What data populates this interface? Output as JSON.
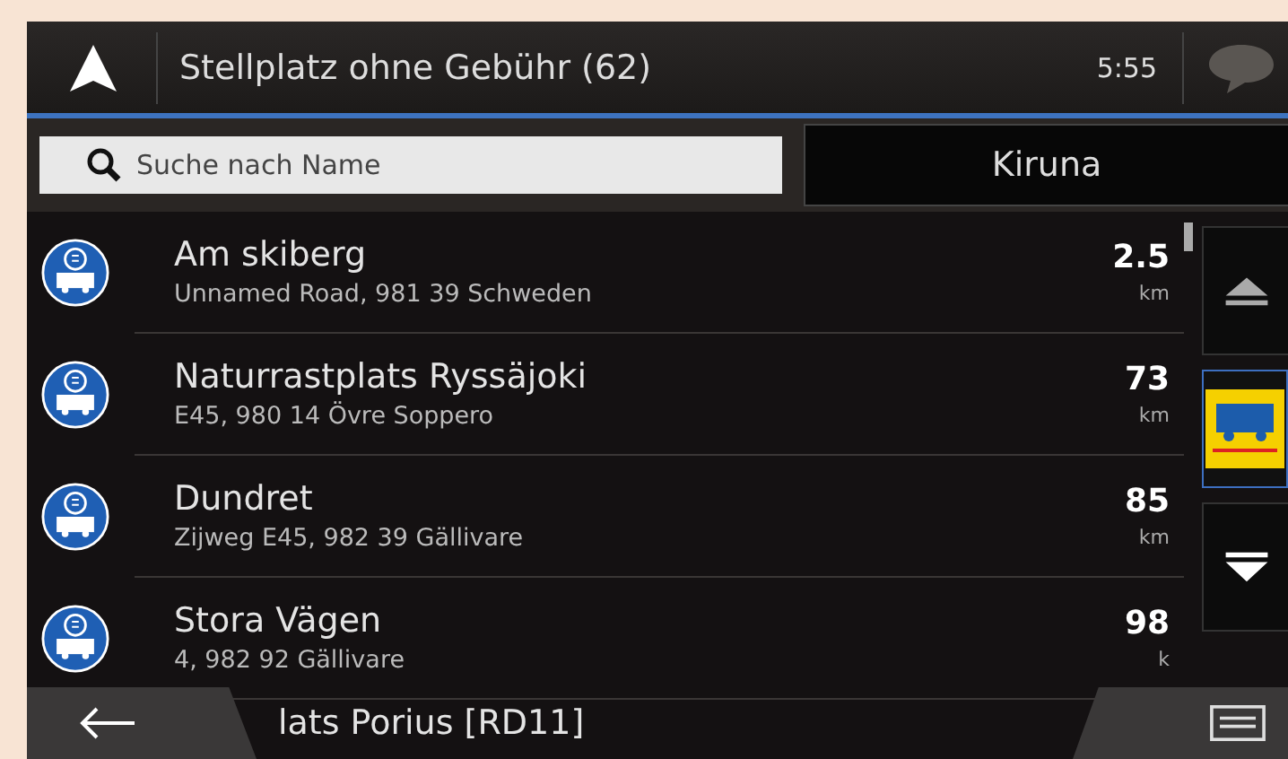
{
  "header": {
    "title": "Stellplatz ohne Gebühr (62)",
    "time": "5:55"
  },
  "search": {
    "placeholder": "Suche nach Name",
    "location": "Kiruna"
  },
  "items": [
    {
      "kind": "full",
      "name": "Am skiberg",
      "address": "Unnamed Road, 981 39 Schweden",
      "distance": "2.5",
      "unit": "km"
    },
    {
      "kind": "full",
      "name": "Naturrastplats Ryssäjoki",
      "address": "E45, 980 14 Övre Soppero",
      "distance": "73",
      "unit": "km"
    },
    {
      "kind": "full",
      "name": "Dundret",
      "address": "Zijweg E45, 982 39 Gällivare",
      "distance": "85",
      "unit": "km"
    },
    {
      "kind": "full",
      "name": "Stora Vägen",
      "address": "4, 982 92 Gällivare",
      "distance": "98",
      "unit": "k"
    },
    {
      "kind": "cut",
      "name": "lats Porius [RD11]"
    }
  ]
}
